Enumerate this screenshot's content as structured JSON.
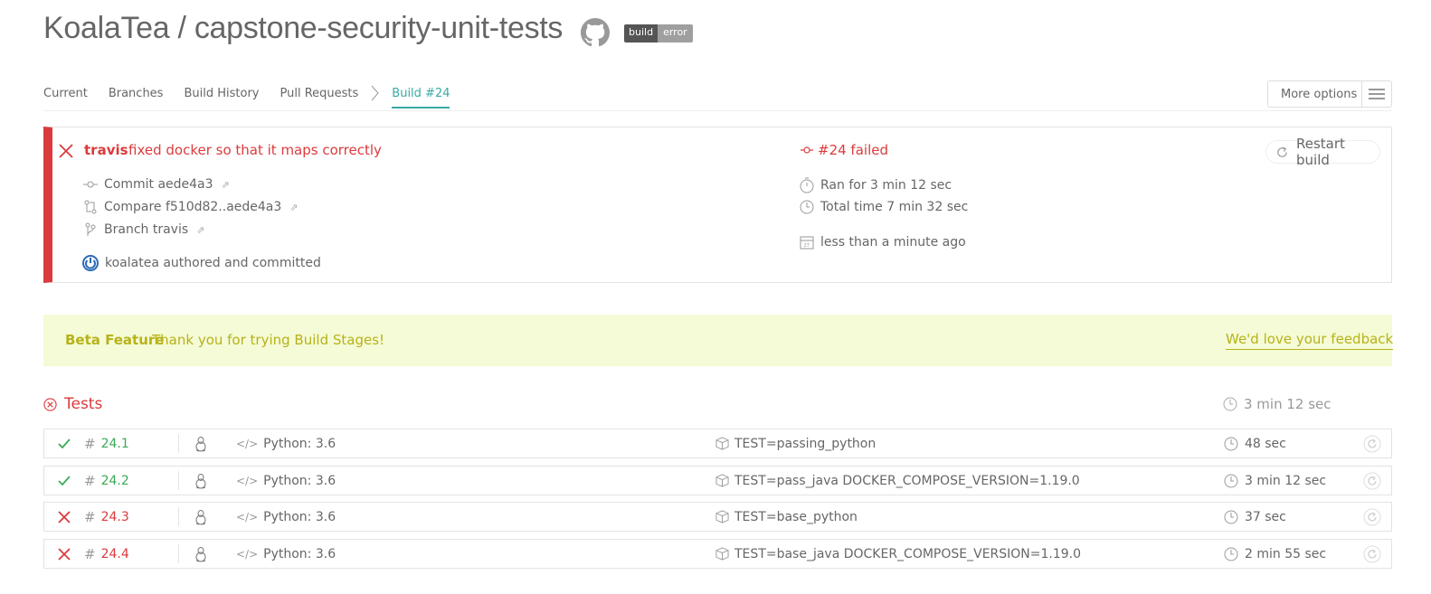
{
  "header": {
    "repo_title": "KoalaTea / capstone-security-unit-tests",
    "badge_left": "build",
    "badge_right": "error"
  },
  "tabs": [
    {
      "label": "Current"
    },
    {
      "label": "Branches"
    },
    {
      "label": "Build History"
    },
    {
      "label": "Pull Requests"
    },
    {
      "label": "Build #24",
      "active": true
    }
  ],
  "more_options_label": "More options",
  "build": {
    "branch": "travis",
    "message": "fixed docker so that it maps correctly",
    "commit": "Commit aede4a3",
    "compare": "Compare f510d82..aede4a3",
    "branch_link": "Branch travis",
    "author": "koalatea authored and committed",
    "state": "#24 failed",
    "ran_for": "Ran for 3 min 12 sec",
    "total_time": "Total time 7 min 32 sec",
    "finished": "less than a minute ago",
    "restart_label": "Restart build",
    "status_color": "#db3a3c"
  },
  "beta": {
    "title": "Beta Feature",
    "message": "Thank you for trying Build Stages!",
    "link": "We'd love your feedback"
  },
  "stage": {
    "name": "Tests",
    "duration": "3 min 12 sec"
  },
  "jobs": [
    {
      "number": "24.1",
      "state": "passed",
      "language": "Python: 3.6",
      "env": "TEST=passing_python",
      "duration": "48 sec"
    },
    {
      "number": "24.2",
      "state": "passed",
      "language": "Python: 3.6",
      "env": "TEST=pass_java DOCKER_COMPOSE_VERSION=1.19.0",
      "duration": "3 min 12 sec"
    },
    {
      "number": "24.3",
      "state": "failed",
      "language": "Python: 3.6",
      "env": "TEST=base_python",
      "duration": "37 sec"
    },
    {
      "number": "24.4",
      "state": "failed",
      "language": "Python: 3.6",
      "env": "TEST=base_java DOCKER_COMPOSE_VERSION=1.19.0",
      "duration": "2 min 55 sec"
    }
  ],
  "colors": {
    "accent": "#39aaa4",
    "failed": "#db3a3c",
    "passed": "#39aa56",
    "beta_bg": "#f4fbd6",
    "beta_text": "#b8b21a"
  }
}
